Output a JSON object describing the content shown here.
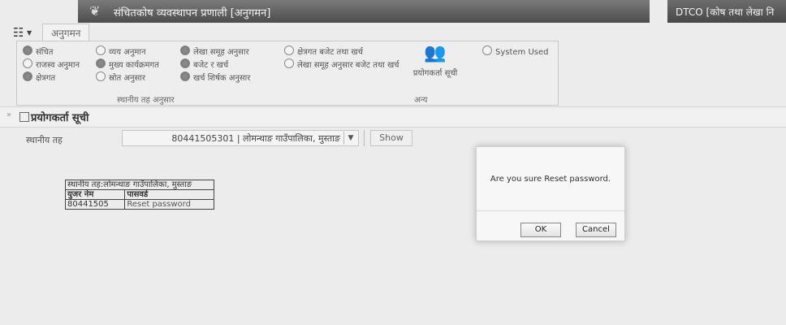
{
  "titlebar": {
    "app_title": "संचितकोष व्यवस्थापन प्रणाली [अनुगमन]",
    "right_title": "DTCO [कोष तथा लेखा नि"
  },
  "menubar": {
    "tab_label": "अनुगमन"
  },
  "ribbon": {
    "options": [
      {
        "label": "संचित",
        "selected": true
      },
      {
        "label": "राजस्व अनुमान",
        "selected": false
      },
      {
        "label": "क्षेत्रगत",
        "selected": true
      },
      {
        "label": "व्यय अनुमान",
        "selected": false
      },
      {
        "label": "मुख्य कार्यक्रमगत",
        "selected": true
      },
      {
        "label": "स्रोत अनुसार",
        "selected": false
      },
      {
        "label": "लेखा समूह अनुसार",
        "selected": true
      },
      {
        "label": "बजेट र खर्च",
        "selected": true
      },
      {
        "label": "खर्च शिर्षक अनुसार",
        "selected": true
      },
      {
        "label": "क्षेत्रगत बजेट तथा खर्च",
        "selected": false
      },
      {
        "label": "लेखा समूह अनुसार बजेट तथा खर्च",
        "selected": false
      },
      {
        "label": "System Used",
        "selected": false
      }
    ],
    "group_local": "स्थानीय तह अनुसार",
    "group_other": "अन्य",
    "user_list_label": "प्रयोगकर्ता सूची"
  },
  "section": {
    "title": "प्रयोगकर्ता सूची"
  },
  "filter": {
    "label": "स्थानीय तह",
    "selected_value": "80441505301 | लोमन्थाङ गाउँपालिका, मुस्ताङ",
    "show_label": "Show"
  },
  "result": {
    "header": "स्थानीय तह:लोमन्थाङ गाउँपालिका, मुस्ताङ",
    "col_username": "युजर नेम",
    "col_password": "पासवर्ड",
    "row_username": "80441505",
    "row_action": "Reset password"
  },
  "dialog": {
    "message": "Are you sure Reset password.",
    "ok_label": "OK",
    "cancel_label": "Cancel"
  }
}
